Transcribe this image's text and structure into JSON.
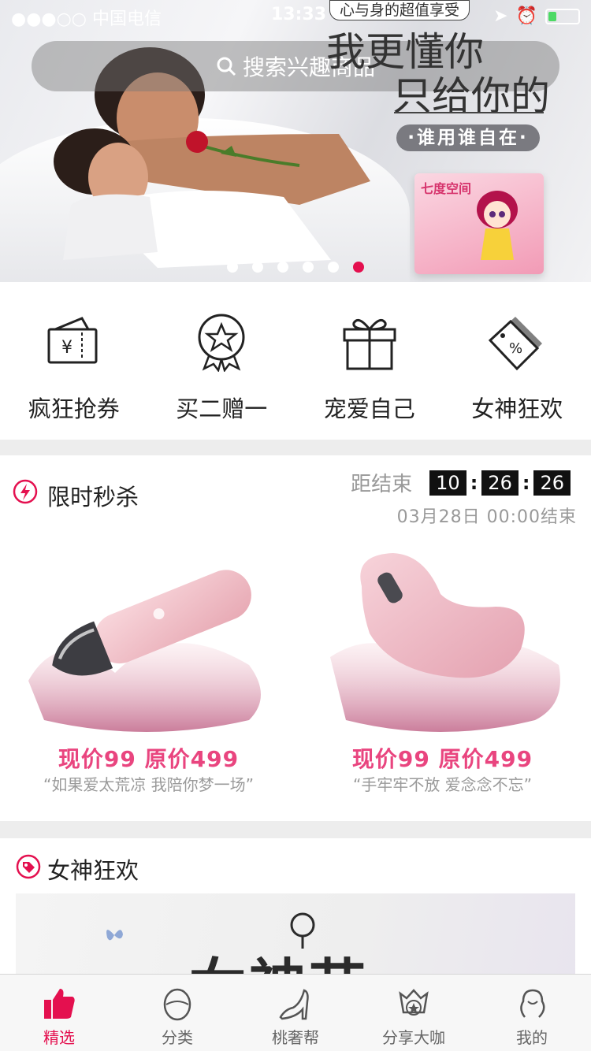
{
  "status_bar": {
    "carrier": "●●●○○ 中国电信",
    "time": "13:33"
  },
  "search": {
    "placeholder": "搜索兴趣商品"
  },
  "banner": {
    "tag": "心与身的超值享受",
    "line1": "我更懂你",
    "line2": "只给你的",
    "pill": "·谁用谁自在·",
    "package_brand": "七度空间",
    "dots": 6,
    "active_dot": 5
  },
  "quick_entries": [
    {
      "label": "疯狂抢券",
      "icon": "coupon-icon"
    },
    {
      "label": "买二赠一",
      "icon": "star-badge-icon"
    },
    {
      "label": "宠爱自己",
      "icon": "gift-icon"
    },
    {
      "label": "女神狂欢",
      "icon": "discount-tag-icon"
    }
  ],
  "flash_sale": {
    "title": "限时秒杀",
    "countdown_label": "距结束",
    "hours": "10",
    "minutes": "26",
    "seconds": "26",
    "end_text": "03月28日  00:00结束",
    "products": [
      {
        "price": "现价99   原价499",
        "slogan": "“如果爱太荒凉 我陪你梦一场”"
      },
      {
        "price": "现价99   原价499",
        "slogan": "“手牢牢不放 爱念念不忘”"
      }
    ]
  },
  "goddess": {
    "title": "女神狂欢",
    "banner_text": "女神节"
  },
  "tabs": [
    {
      "label": "精选",
      "icon": "thumbs-up-icon",
      "active": true
    },
    {
      "label": "分类",
      "icon": "egg-category-icon",
      "active": false
    },
    {
      "label": "桃奢帮",
      "icon": "high-heel-icon",
      "active": false
    },
    {
      "label": "分享大咖",
      "icon": "crown-badge-icon",
      "active": false
    },
    {
      "label": "我的",
      "icon": "woman-profile-icon",
      "active": false
    }
  ],
  "colors": {
    "accent": "#e4104f",
    "price": "#e9457f"
  }
}
